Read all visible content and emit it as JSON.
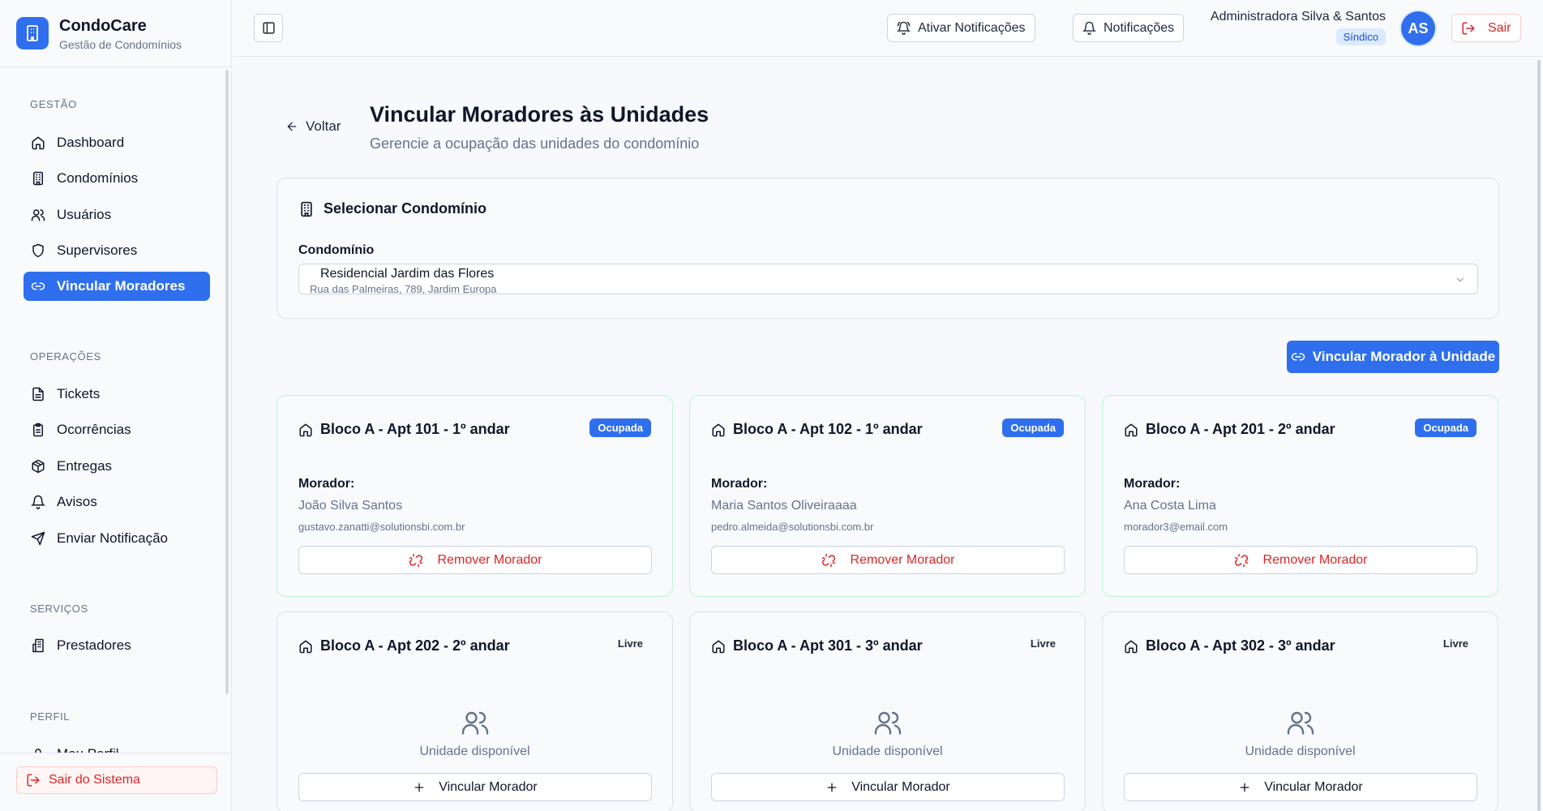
{
  "brand": {
    "name": "CondoCare",
    "subtitle": "Gestão de Condomínios"
  },
  "sidebar": {
    "sections": [
      {
        "label": "GESTÃO"
      },
      {
        "label": "OPERAÇÕES"
      },
      {
        "label": "SERVIÇOS"
      },
      {
        "label": "PERFIL"
      }
    ],
    "items": [
      {
        "label": "Dashboard",
        "icon": "home-icon"
      },
      {
        "label": "Condomínios",
        "icon": "building-icon"
      },
      {
        "label": "Usuários",
        "icon": "users-icon"
      },
      {
        "label": "Supervisores",
        "icon": "shield-icon"
      },
      {
        "label": "Vincular Moradores",
        "icon": "link-icon",
        "active": true
      },
      {
        "label": "Tickets",
        "icon": "file-text-icon"
      },
      {
        "label": "Ocorrências",
        "icon": "clipboard-icon"
      },
      {
        "label": "Entregas",
        "icon": "package-icon"
      },
      {
        "label": "Avisos",
        "icon": "bell-icon"
      },
      {
        "label": "Enviar Notificação",
        "icon": "send-icon"
      },
      {
        "label": "Prestadores",
        "icon": "buildings-icon"
      },
      {
        "label": "Meu Perfil",
        "icon": "user-icon"
      }
    ],
    "logout_label": "Sair do Sistema"
  },
  "header": {
    "enable_notifications_label": "Ativar Notificações",
    "notifications_label": "Notificações",
    "user_name": "Administradora Silva & Santos",
    "user_role": "Síndico",
    "avatar_initials": "AS",
    "exit_label": "Sair"
  },
  "page": {
    "back_label": "Voltar",
    "title": "Vincular Moradores às Unidades",
    "subtitle": "Gerencie a ocupação das unidades do condomínio"
  },
  "condo_select": {
    "heading": "Selecionar Condomínio",
    "field_label": "Condomínio",
    "selected_name": "Residencial Jardim das Flores",
    "selected_address": "Rua das Palmeiras, 789, Jardim Europa"
  },
  "link_button_label": "Vincular Morador à Unidade",
  "labels": {
    "resident": "Morador:",
    "remove": "Remover Morador",
    "available": "Unidade disponível",
    "link": "Vincular Morador"
  },
  "units": [
    {
      "title": "Bloco A - Apt 101 - 1º andar",
      "status": "Ocupada",
      "occupied": true,
      "resident_name": "João Silva Santos",
      "resident_email": "gustavo.zanatti@solutionsbi.com.br"
    },
    {
      "title": "Bloco A - Apt 102 - 1º andar",
      "status": "Ocupada",
      "occupied": true,
      "resident_name": "Maria Santos Oliveiraaaa",
      "resident_email": "pedro.almeida@solutionsbi.com.br"
    },
    {
      "title": "Bloco A - Apt 201 - 2º andar",
      "status": "Ocupada",
      "occupied": true,
      "resident_name": "Ana Costa Lima",
      "resident_email": "morador3@email.com"
    },
    {
      "title": "Bloco A - Apt 202 - 2º andar",
      "status": "Livre",
      "occupied": false
    },
    {
      "title": "Bloco A - Apt 301 - 3º andar",
      "status": "Livre",
      "occupied": false
    },
    {
      "title": "Bloco A - Apt 302 - 3º andar",
      "status": "Livre",
      "occupied": false
    }
  ],
  "colors": {
    "primary": "#2f6fed",
    "danger": "#dc2626",
    "occupied_border": "#bbf7d0"
  }
}
